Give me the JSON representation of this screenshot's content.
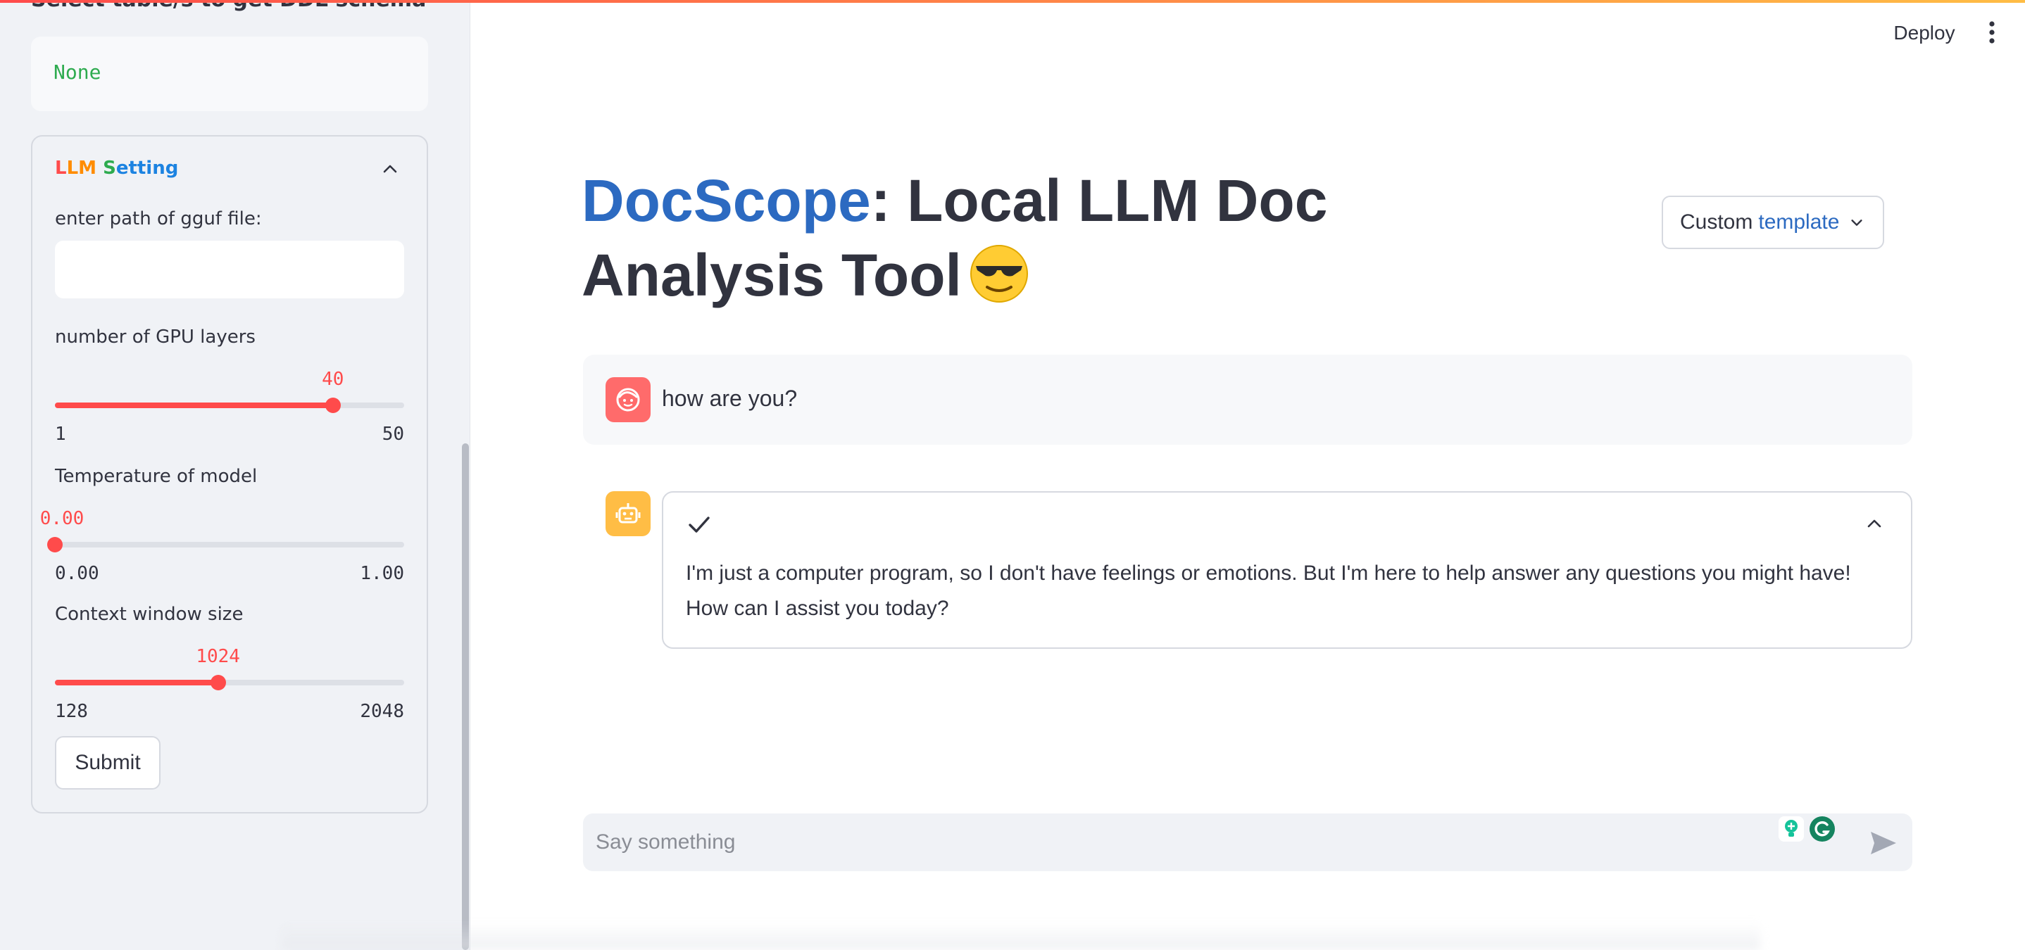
{
  "sidebar": {
    "clipped_title": "Select table/s to get DDL schema",
    "selected_tables_value": "None",
    "llm_setting": {
      "title_parts": [
        "L",
        "L",
        "M",
        " S",
        "etting"
      ],
      "gguf_label": "enter path of gguf file:",
      "gguf_value": "",
      "gpu_layers": {
        "label": "number of GPU layers",
        "value": "40",
        "min": "1",
        "max": "50",
        "fraction": 0.796
      },
      "temperature": {
        "label": "Temperature of model",
        "value": "0.00",
        "min": "0.00",
        "max": "1.00",
        "fraction": 0.0
      },
      "context_window": {
        "label": "Context window size",
        "value": "1024",
        "min": "128",
        "max": "2048",
        "fraction": 0.467
      },
      "submit_label": "Submit"
    }
  },
  "header": {
    "deploy_label": "Deploy",
    "menu_icon": "vertical-dots-icon"
  },
  "main": {
    "title_brand": "DocScope",
    "title_rest": ": Local LLM Doc Analysis Tool",
    "title_emoji": "sunglasses-emoji",
    "template_select": {
      "prefix": "Custom",
      "accent": "template"
    },
    "messages": [
      {
        "role": "user",
        "avatar_icon": "user-face-icon",
        "text": "how are you?"
      },
      {
        "role": "assistant",
        "avatar_icon": "robot-icon",
        "status_icon": "check-icon",
        "text": "I'm just a computer program, so I don't have feelings or emotions. But I'm here to help answer any questions you might have! How can I assist you today?"
      }
    ],
    "chat_input": {
      "placeholder": "Say something",
      "value": ""
    }
  },
  "colors": {
    "accent_red": "#ff4b4b",
    "brand_blue": "#2c6ac1",
    "bot_avatar": "#ffbd45",
    "user_avatar": "#ff6b6b",
    "sidebar_bg": "#f0f2f6",
    "success_green": "#2eab4f"
  }
}
